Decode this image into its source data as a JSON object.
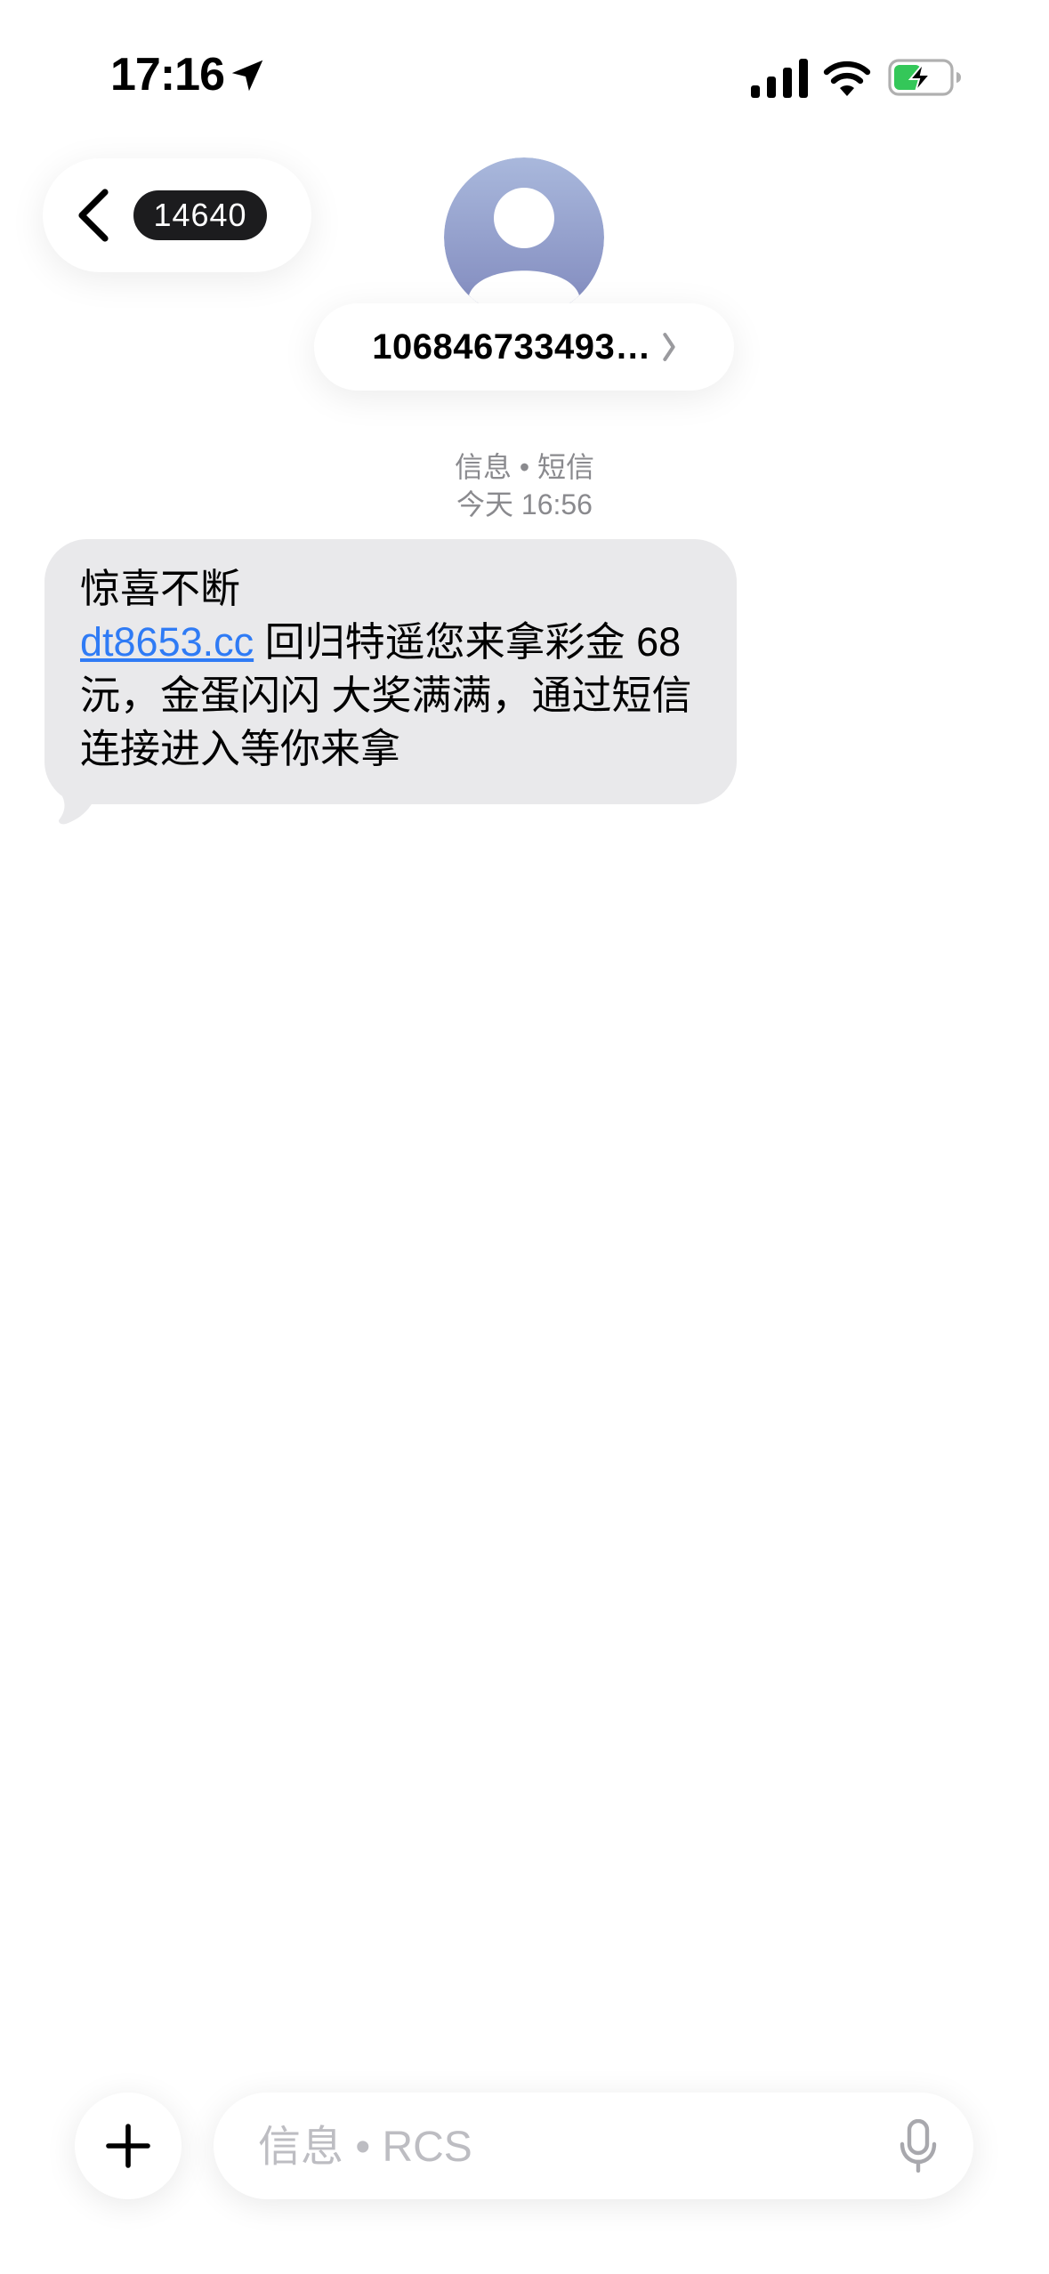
{
  "status_bar": {
    "time": "17:16",
    "icons": [
      "location-arrow-icon",
      "cellular-signal-icon",
      "wifi-icon",
      "battery-charging-icon"
    ],
    "battery_color": "#34c759"
  },
  "nav": {
    "back_icon": "chevron-left-icon",
    "unread_count": "14640",
    "contact_name": "106846733493…",
    "contact_chevron": "chevron-right-icon",
    "avatar_icon": "person-silhouette-icon"
  },
  "thread": {
    "service_label": "信息 • 短信",
    "timestamp": "今天 16:56"
  },
  "message": {
    "line1": "惊喜不断",
    "link": "dt8653.cc",
    "body": " 回归特遥您来拿彩金 68 沅，金蛋闪闪 大奖满满，通过短信连接进入等你来拿",
    "bubble_color": "#e9e9eb",
    "link_color": "#2f7bf5"
  },
  "compose": {
    "add_icon": "plus-icon",
    "placeholder": "信息 • RCS",
    "mic_icon": "microphone-icon"
  }
}
